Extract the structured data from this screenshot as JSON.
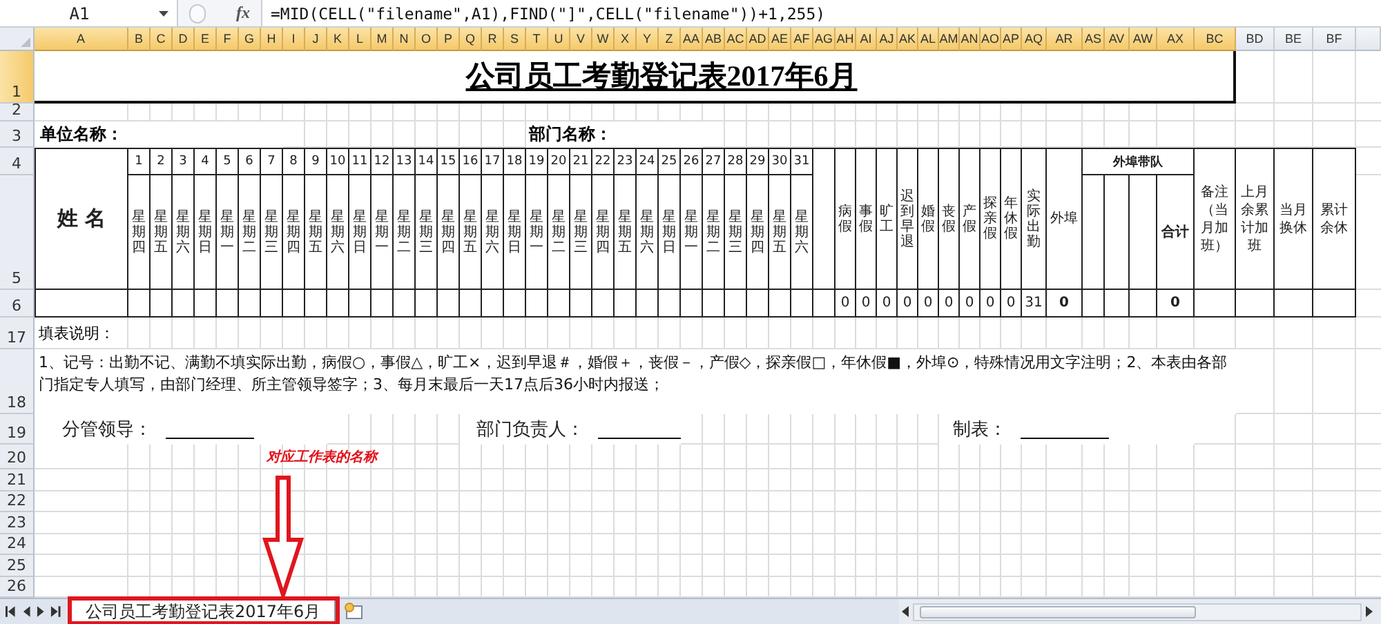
{
  "formula_bar": {
    "name_box": "A1",
    "function_label": "fx",
    "formula": "=MID(CELL(\"filename\",A1),FIND(\"]\",CELL(\"filename\"))+1,255)"
  },
  "columns": [
    {
      "label": "A",
      "selected": true
    },
    {
      "label": "B",
      "selected": true
    },
    {
      "label": "C",
      "selected": true
    },
    {
      "label": "D",
      "selected": true
    },
    {
      "label": "E",
      "selected": true
    },
    {
      "label": "F",
      "selected": true
    },
    {
      "label": "G",
      "selected": true
    },
    {
      "label": "H",
      "selected": true
    },
    {
      "label": "I",
      "selected": true
    },
    {
      "label": "J",
      "selected": true
    },
    {
      "label": "K",
      "selected": true
    },
    {
      "label": "L",
      "selected": true
    },
    {
      "label": "M",
      "selected": true
    },
    {
      "label": "N",
      "selected": true
    },
    {
      "label": "O",
      "selected": true
    },
    {
      "label": "P",
      "selected": true
    },
    {
      "label": "Q",
      "selected": true
    },
    {
      "label": "R",
      "selected": true
    },
    {
      "label": "S",
      "selected": true
    },
    {
      "label": "T",
      "selected": true
    },
    {
      "label": "U",
      "selected": true
    },
    {
      "label": "V",
      "selected": true
    },
    {
      "label": "W",
      "selected": true
    },
    {
      "label": "X",
      "selected": true
    },
    {
      "label": "Y",
      "selected": true
    },
    {
      "label": "Z",
      "selected": true
    },
    {
      "label": "AA",
      "selected": true
    },
    {
      "label": "AB",
      "selected": true
    },
    {
      "label": "AC",
      "selected": true
    },
    {
      "label": "AD",
      "selected": true
    },
    {
      "label": "AE",
      "selected": true
    },
    {
      "label": "AF",
      "selected": true
    },
    {
      "label": "AG",
      "selected": true
    },
    {
      "label": "AH",
      "selected": true
    },
    {
      "label": "AI",
      "selected": true
    },
    {
      "label": "AJ",
      "selected": true
    },
    {
      "label": "AK",
      "selected": true
    },
    {
      "label": "AL",
      "selected": true
    },
    {
      "label": "AM",
      "selected": true
    },
    {
      "label": "AN",
      "selected": true
    },
    {
      "label": "AO",
      "selected": true
    },
    {
      "label": "AP",
      "selected": true
    },
    {
      "label": "AQ",
      "selected": true
    },
    {
      "label": "AR",
      "selected": true
    },
    {
      "label": "AS",
      "selected": true
    },
    {
      "label": "AV",
      "selected": true
    },
    {
      "label": "AW",
      "selected": true
    },
    {
      "label": "AX",
      "selected": true
    },
    {
      "label": "BC",
      "selected": true
    },
    {
      "label": "BD",
      "selected": false
    },
    {
      "label": "BE",
      "selected": false
    },
    {
      "label": "BF",
      "selected": false
    }
  ],
  "rows": [
    {
      "label": "1",
      "selected": true
    },
    {
      "label": "2",
      "selected": false
    },
    {
      "label": "3",
      "selected": false
    },
    {
      "label": "4",
      "selected": false
    },
    {
      "label": "5",
      "selected": false
    },
    {
      "label": "6",
      "selected": false
    },
    {
      "label": "17",
      "selected": false
    },
    {
      "label": "18",
      "selected": false
    },
    {
      "label": "19",
      "selected": false
    },
    {
      "label": "20",
      "selected": false
    },
    {
      "label": "21",
      "selected": false
    },
    {
      "label": "22",
      "selected": false
    },
    {
      "label": "23",
      "selected": false
    },
    {
      "label": "24",
      "selected": false
    },
    {
      "label": "25",
      "selected": false
    },
    {
      "label": "26",
      "selected": false
    }
  ],
  "sheet": {
    "title": "公司员工考勤登记表2017年6月",
    "unit_label": "单位名称：",
    "department_label": "部门名称：",
    "name_header": "姓 名",
    "days": [
      {
        "day": "1",
        "weekday": "星期四"
      },
      {
        "day": "2",
        "weekday": "星期五"
      },
      {
        "day": "3",
        "weekday": "星期六"
      },
      {
        "day": "4",
        "weekday": "星期日"
      },
      {
        "day": "5",
        "weekday": "星期一"
      },
      {
        "day": "6",
        "weekday": "星期二"
      },
      {
        "day": "7",
        "weekday": "星期三"
      },
      {
        "day": "8",
        "weekday": "星期四"
      },
      {
        "day": "9",
        "weekday": "星期五"
      },
      {
        "day": "10",
        "weekday": "星期六"
      },
      {
        "day": "11",
        "weekday": "星期日"
      },
      {
        "day": "12",
        "weekday": "星期一"
      },
      {
        "day": "13",
        "weekday": "星期二"
      },
      {
        "day": "14",
        "weekday": "星期三"
      },
      {
        "day": "15",
        "weekday": "星期四"
      },
      {
        "day": "16",
        "weekday": "星期五"
      },
      {
        "day": "17",
        "weekday": "星期六"
      },
      {
        "day": "18",
        "weekday": "星期日"
      },
      {
        "day": "19",
        "weekday": "星期一"
      },
      {
        "day": "20",
        "weekday": "星期二"
      },
      {
        "day": "21",
        "weekday": "星期三"
      },
      {
        "day": "22",
        "weekday": "星期四"
      },
      {
        "day": "23",
        "weekday": "星期五"
      },
      {
        "day": "24",
        "weekday": "星期六"
      },
      {
        "day": "25",
        "weekday": "星期日"
      },
      {
        "day": "26",
        "weekday": "星期一"
      },
      {
        "day": "27",
        "weekday": "星期二"
      },
      {
        "day": "28",
        "weekday": "星期三"
      },
      {
        "day": "29",
        "weekday": "星期四"
      },
      {
        "day": "30",
        "weekday": "星期五"
      },
      {
        "day": "31",
        "weekday": "星期六"
      }
    ],
    "leave_columns": [
      {
        "label": "病假",
        "value": "0"
      },
      {
        "label": "事假",
        "value": "0"
      },
      {
        "label": "旷工",
        "value": "0"
      },
      {
        "label": "迟到早退",
        "value": "0"
      },
      {
        "label": "婚假",
        "value": "0"
      },
      {
        "label": "丧假",
        "value": "0"
      },
      {
        "label": "产假",
        "value": "0"
      },
      {
        "label": "探亲假",
        "value": "0"
      },
      {
        "label": "年休假",
        "value": "0"
      },
      {
        "label": "实际出勤",
        "value": "31"
      }
    ],
    "outside": {
      "label": "外埠",
      "value": "0"
    },
    "team": {
      "label": "外埠带队",
      "total_label": "合计",
      "total": "0"
    },
    "extra_columns": [
      "备注（当月加班）",
      "上月余累计加班",
      "当月换休",
      "累计余休"
    ],
    "notes_title": "填表说明：",
    "notes": "1、记号：出勤不记、满勤不填实际出勤，病假○，事假△，旷工×，迟到早退＃，婚假＋，丧假－，产假◇，探亲假□，年休假■，外埠⊙，特殊情况用文字注明；2、本表由各部门指定专人填写，由部门经理、所主管领导签字；3、每月末最后一天17点后36小时内报送；",
    "signatures": [
      "分管领导：",
      "部门负责人：",
      "制表："
    ]
  },
  "annotation": "对应工作表的名称",
  "sheet_tabs": [
    {
      "label": "公司员工考勤登记表2017年6月",
      "selected": true
    }
  ]
}
